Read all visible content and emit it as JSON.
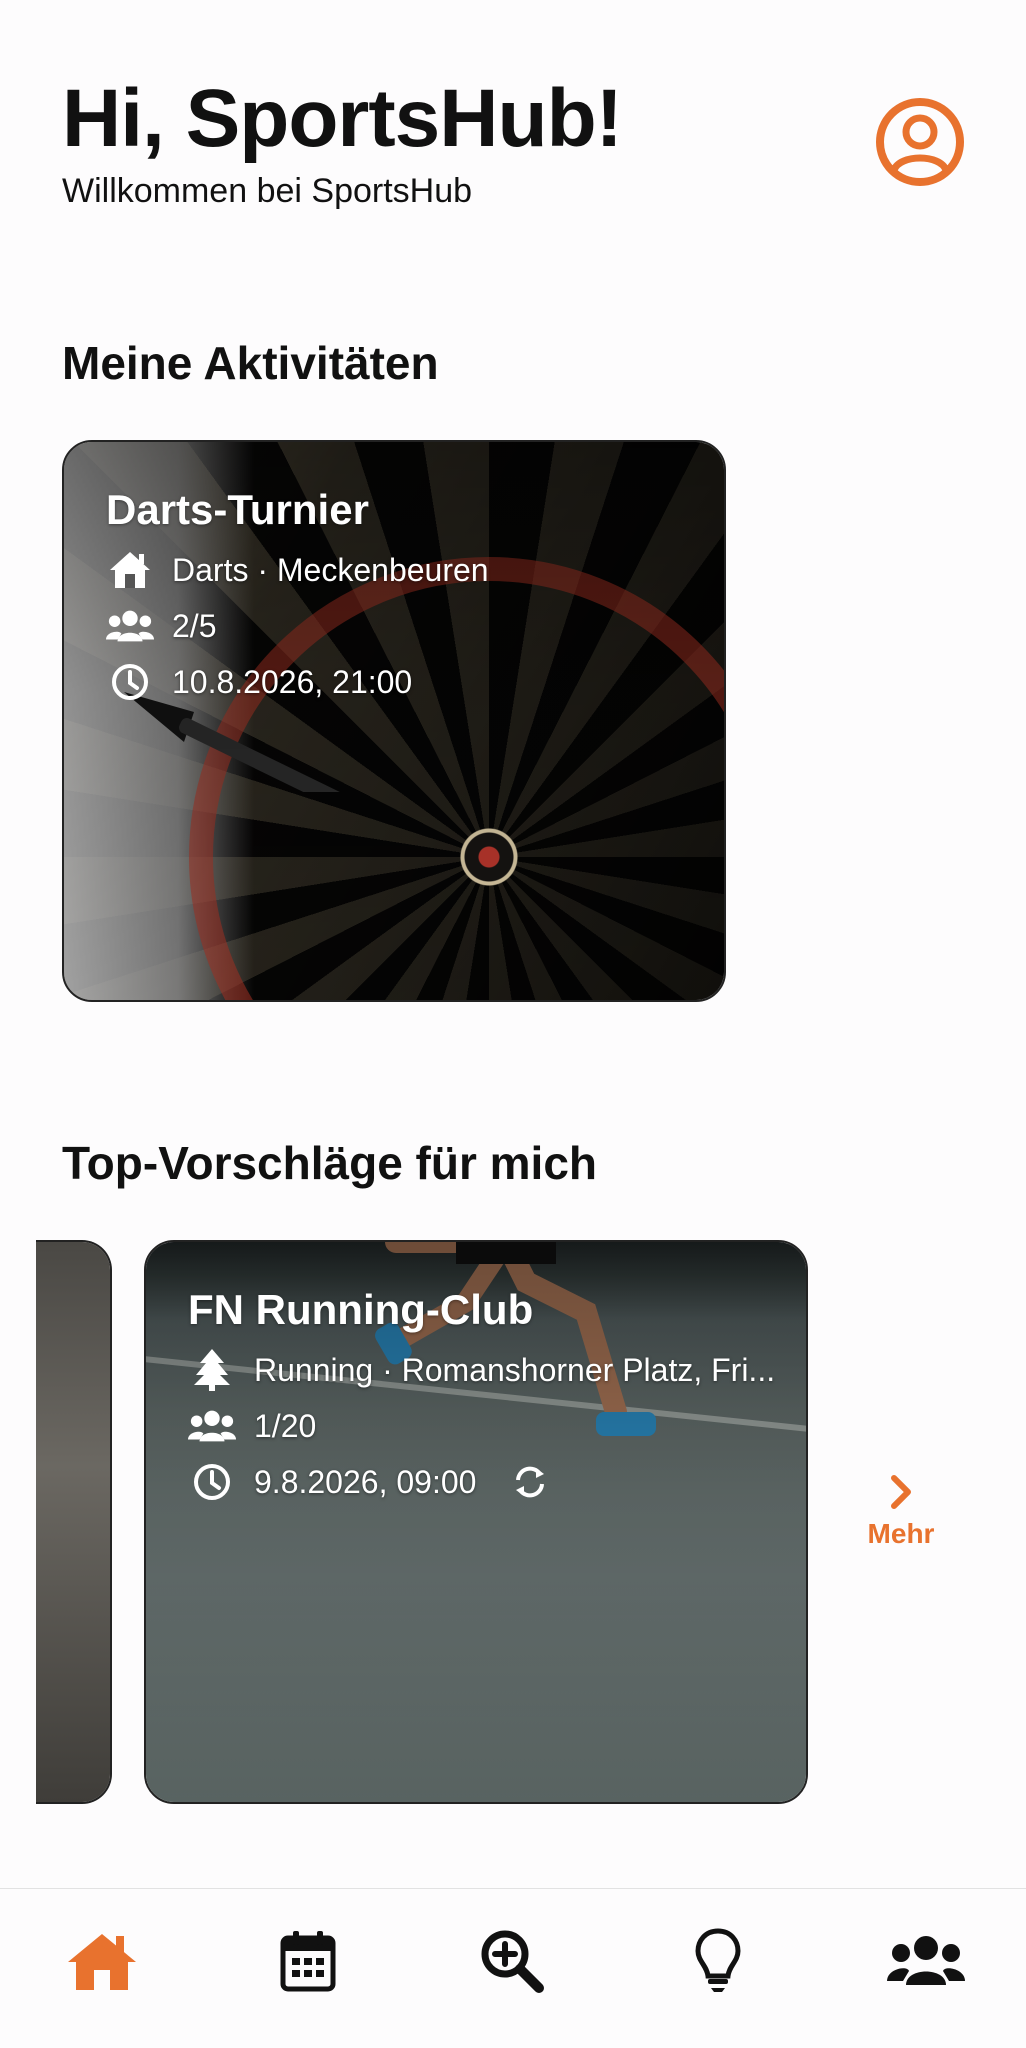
{
  "header": {
    "greeting": "Hi, SportsHub!",
    "subtitle": "Willkommen bei SportsHub",
    "profile_icon": "user-circle-icon"
  },
  "sections": {
    "activities_title": "Meine Aktivitäten",
    "suggestions_title": "Top-Vorschläge für mich"
  },
  "activities": [
    {
      "title": "Darts-Turnier",
      "location_icon": "house-icon",
      "location": "Darts · Meckenbeuren",
      "participants_icon": "users-icon",
      "participants": "2/5",
      "time_icon": "clock-icon",
      "datetime": "10.8.2026, 21:00"
    }
  ],
  "suggestions": [
    {
      "title": "FN Running-Club",
      "location_icon": "tree-icon",
      "location": "Running · Romanshorner Platz, Fri...",
      "participants_icon": "users-icon",
      "participants": "1/20",
      "time_icon": "clock-icon",
      "datetime": "9.8.2026, 09:00",
      "recurring_icon": "repeat-icon"
    }
  ],
  "more": {
    "label": "Mehr",
    "icon": "chevron-right-icon"
  },
  "nav": [
    {
      "icon": "home-icon",
      "active": true
    },
    {
      "icon": "calendar-icon",
      "active": false
    },
    {
      "icon": "search-plus-icon",
      "active": false
    },
    {
      "icon": "lightbulb-icon",
      "active": false
    },
    {
      "icon": "users-icon",
      "active": false
    }
  ],
  "colors": {
    "accent": "#e8722e",
    "text": "#111111",
    "background": "#fdfcfd"
  }
}
